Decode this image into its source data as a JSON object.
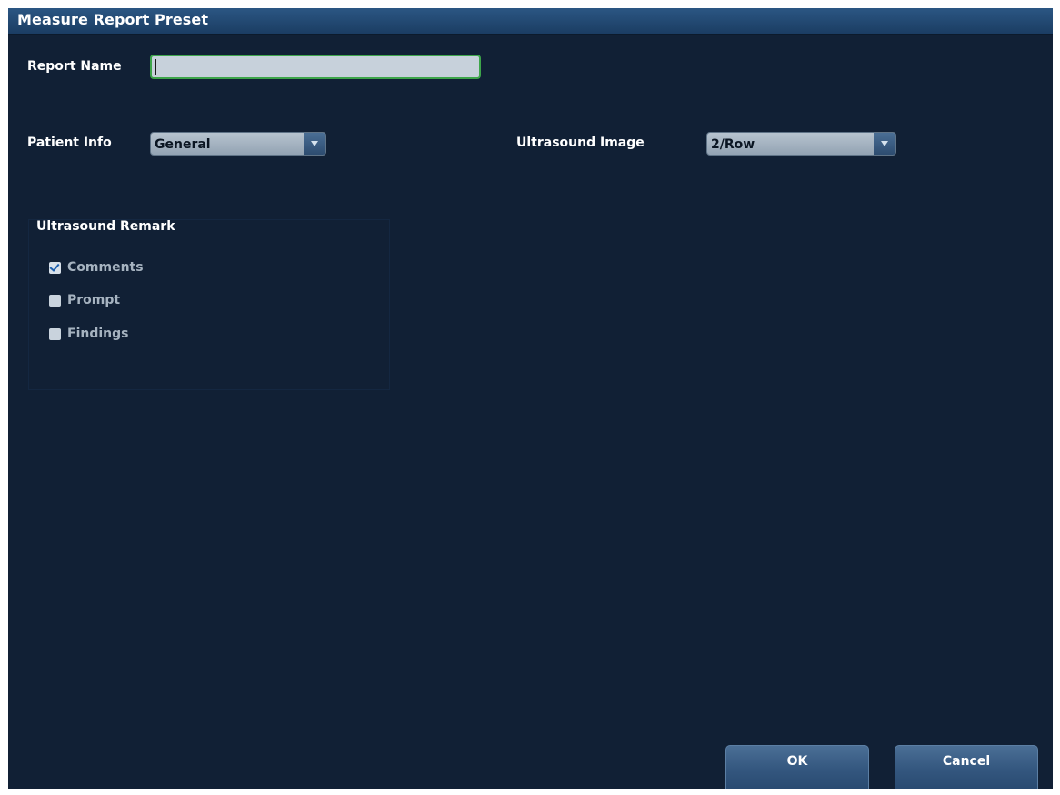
{
  "dialog": {
    "title": "Measure Report Preset"
  },
  "report_name": {
    "label": "Report Name",
    "value": ""
  },
  "patient_info": {
    "label": "Patient Info",
    "selected": "General"
  },
  "ultrasound_image": {
    "label": "Ultrasound Image",
    "selected": "2/Row"
  },
  "ultrasound_remark": {
    "title": "Ultrasound Remark",
    "options": [
      {
        "label": "Comments",
        "checked": true
      },
      {
        "label": "Prompt",
        "checked": false
      },
      {
        "label": "Findings",
        "checked": false
      }
    ]
  },
  "buttons": {
    "ok": "OK",
    "cancel": "Cancel"
  },
  "colors": {
    "background": "#112035",
    "title_bar": "#1f4670",
    "input_focus_border": "#3da54a",
    "checkbox_check": "#1c5fae"
  }
}
